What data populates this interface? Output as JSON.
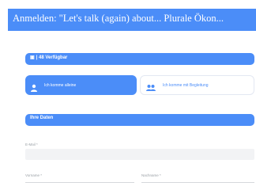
{
  "header": {
    "title": "Anmelden: \"Let's talk (again) about... Plurale Ökon..."
  },
  "availability_bar": {
    "label": "| 48 Verfügbar"
  },
  "options": {
    "alone": "Ich komme alleine",
    "companion": "Ich komme mit Begleitung"
  },
  "section": {
    "label": "Ihre Daten"
  },
  "form": {
    "email_label": "E-Mail *",
    "firstname_label": "Vorname *",
    "lastname_label": "Nachname *"
  },
  "colors": {
    "accent": "#4b8df8",
    "background": "#ffffff"
  }
}
